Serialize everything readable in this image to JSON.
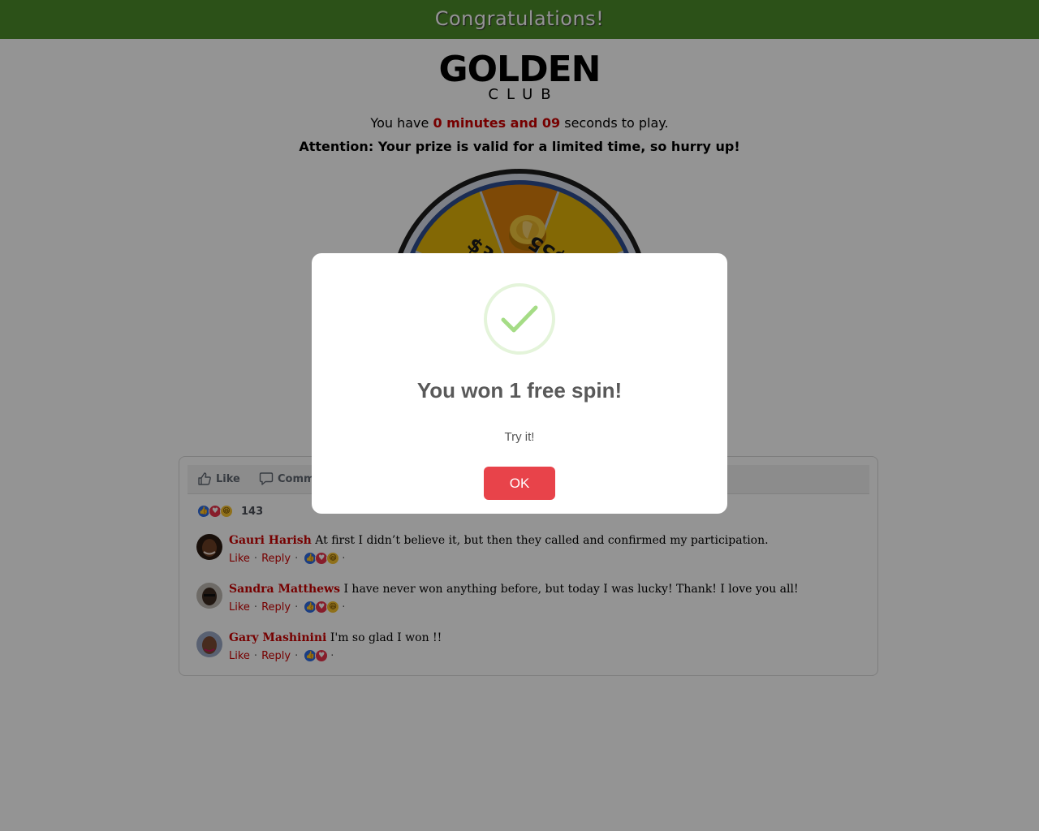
{
  "header": {
    "title": "Congratulations!",
    "bar_color": "#4d8c2a"
  },
  "logo": {
    "main": "GOLDEN",
    "sub": "CLUB"
  },
  "timer": {
    "prefix": "You have",
    "highlight": "0 minutes and 09",
    "suffix": "seconds to play."
  },
  "attention": "Attention: Your prize is valid for a limited time, so hurry up!",
  "wheel": {
    "visible_labels": [
      "$300",
      "$55"
    ]
  },
  "social": {
    "actions": [
      {
        "label": "Like",
        "icon": "thumbs-up-icon"
      },
      {
        "label": "Comm",
        "icon": "comment-icon"
      }
    ],
    "reaction_total": "143",
    "comments": [
      {
        "name": "Gauri Harish",
        "text": "At first I didn’t believe it, but then they called and confirmed my participation.",
        "like": "Like",
        "reply": "Reply",
        "reactions": [
          "like",
          "love",
          "haha"
        ]
      },
      {
        "name": "Sandra Matthews",
        "text": "I have never won anything before, but today I was lucky! Thank! I love you all!",
        "like": "Like",
        "reply": "Reply",
        "reactions": [
          "like",
          "love",
          "haha"
        ]
      },
      {
        "name": "Gary Mashinini",
        "text": "I'm so glad I won !!",
        "like": "Like",
        "reply": "Reply",
        "reactions": [
          "like",
          "love"
        ]
      }
    ]
  },
  "modal": {
    "icon": "checkmark-icon",
    "title": "You won 1 free spin!",
    "text": "Try it!",
    "button": "OK",
    "button_color": "#e8434a"
  }
}
